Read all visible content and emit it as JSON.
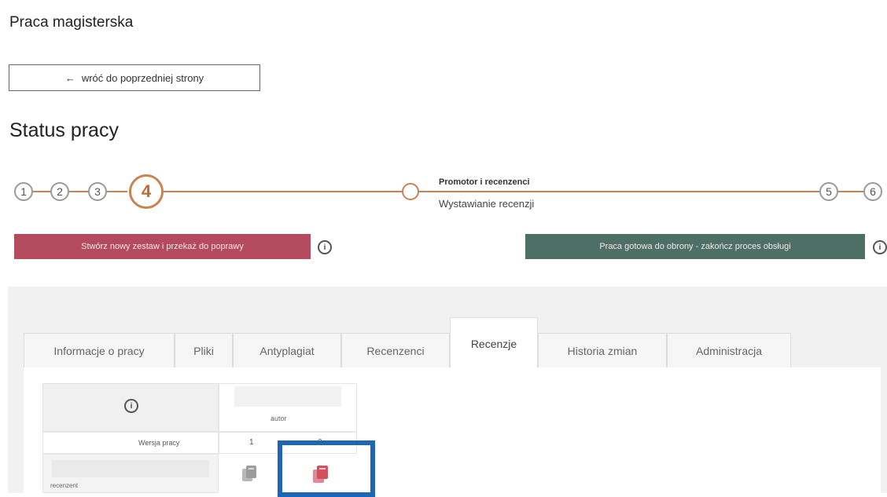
{
  "page_title": "Praca magisterska",
  "back_button": {
    "arrow": "←",
    "label": "wróć do poprzedniej strony"
  },
  "status_heading": "Status pracy",
  "stepper": {
    "steps": [
      "1",
      "2",
      "3",
      "4",
      "5",
      "6"
    ],
    "active_step": "4",
    "current_title": "Promotor i recenzenci",
    "current_subtitle": "Wystawianie recenzji"
  },
  "actions": {
    "new_set_label": "Stwórz nowy zestaw i przekaż do poprawy",
    "ready_label": "Praca gotowa do obrony - zakończ proces obsługi",
    "info_glyph": "i"
  },
  "tabs": [
    "Informacje o pracy",
    "Pliki",
    "Antyplagiat",
    "Recenzenci",
    "Recenzje",
    "Historia zmian",
    "Administracja"
  ],
  "active_tab": "Recenzje",
  "table": {
    "header_info_glyph": "i",
    "col_author": "autor",
    "row_version_label": "Wersja pracy",
    "versions": [
      "1",
      "2"
    ],
    "row_reviewer_label": "recenzent"
  },
  "colors": {
    "accent_orange": "#c98350",
    "danger_button": "#b34a5e",
    "success_button": "#4d6f66",
    "highlight_box": "#1d66b5",
    "doc_icon_active": "#d5505f",
    "doc_icon_inactive": "#a8a8a8"
  },
  "icons": {
    "back": "arrow-left-icon",
    "info": "info-icon",
    "document_copy": "document-copy-icon"
  }
}
